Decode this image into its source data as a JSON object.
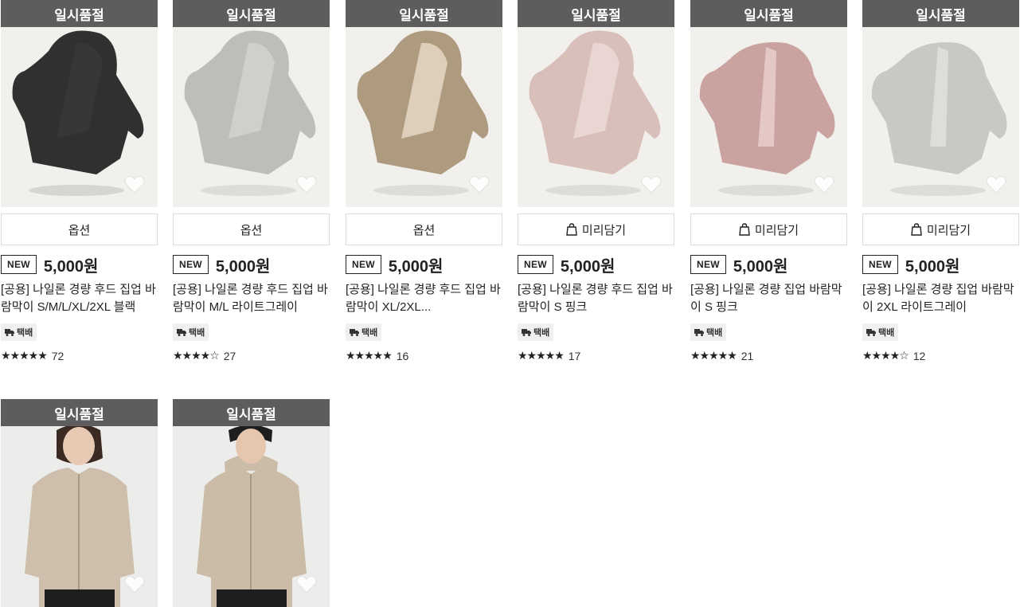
{
  "products": [
    {
      "badge": "일시품절",
      "option_label": "옵션",
      "new_tag": "NEW",
      "price": "5,000원",
      "title": "[공용] 나일론 경량 후드 집업 바람막이 S/M/L/XL/2XL 블랙",
      "shipping": "택배",
      "rating_stars": "★★★★★",
      "review_count": "72",
      "color": "#1f1f1f",
      "photo_icon": "hooded-jacket-black"
    },
    {
      "badge": "일시품절",
      "option_label": "옵션",
      "new_tag": "NEW",
      "price": "5,000원",
      "title": "[공용] 나일론 경량 후드 집업 바람막이 M/L 라이트그레이",
      "shipping": "택배",
      "rating_stars": "★★★★☆",
      "review_count": "27",
      "color": "#bdbdb8",
      "photo_icon": "hooded-jacket-lightgray"
    },
    {
      "badge": "일시품절",
      "option_label": "옵션",
      "new_tag": "NEW",
      "price": "5,000원",
      "title": "[공용] 나일론 경량 후드 집업 바람막이 XL/2XL...",
      "shipping": "택배",
      "rating_stars": "★★★★★",
      "review_count": "16",
      "color": "#a48d6f",
      "photo_icon": "hooded-jacket-beige"
    },
    {
      "badge": "일시품절",
      "option_label": "미리담기",
      "new_tag": "NEW",
      "price": "5,000원",
      "title": "[공용] 나일론 경량 후드 집업 바람막이 S 핑크",
      "shipping": "택배",
      "rating_stars": "★★★★★",
      "review_count": "17",
      "color": "#d6b9b4",
      "photo_icon": "hooded-jacket-pink"
    },
    {
      "badge": "일시품절",
      "option_label": "미리담기",
      "new_tag": "NEW",
      "price": "5,000원",
      "title": "[공용] 나일론 경량 집업 바람막이 S 핑크",
      "shipping": "택배",
      "rating_stars": "★★★★★",
      "review_count": "21",
      "color": "#c79b98",
      "photo_icon": "zip-jacket-pink"
    },
    {
      "badge": "일시품절",
      "option_label": "미리담기",
      "new_tag": "NEW",
      "price": "5,000원",
      "title": "[공용] 나일론 경량 집업 바람막이 2XL 라이트그레이",
      "shipping": "택배",
      "rating_stars": "★★★★☆",
      "review_count": "12",
      "color": "#c4c4c1",
      "photo_icon": "zip-jacket-lightgray"
    },
    {
      "badge": "일시품절",
      "color": "#cdbfab",
      "photo_icon": "model-woman-beige-jacket"
    },
    {
      "badge": "일시품절",
      "color": "#cbbca7",
      "photo_icon": "model-man-beige-hooded-jacket"
    }
  ]
}
